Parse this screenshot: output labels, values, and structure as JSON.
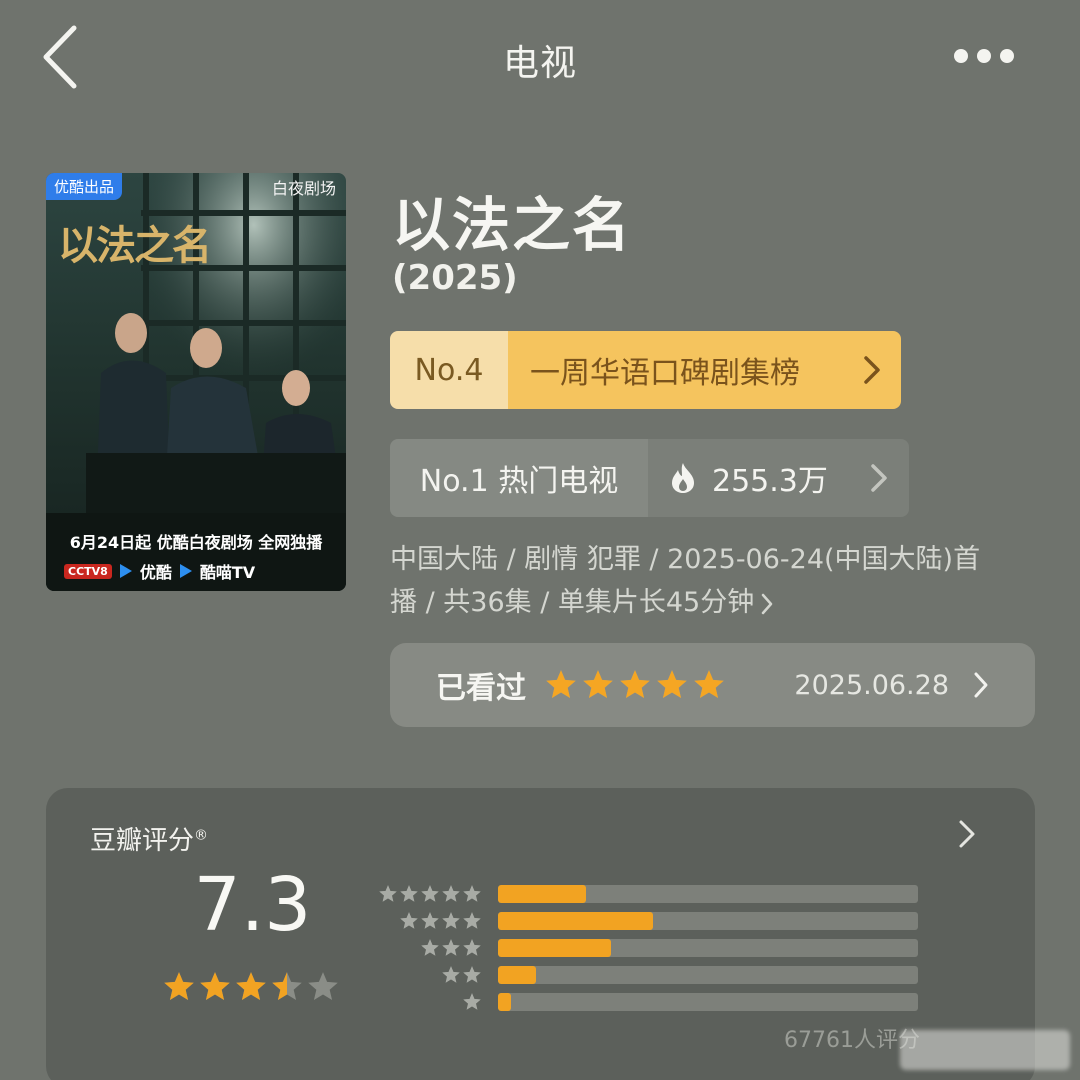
{
  "header": {
    "title": "电视",
    "icons": {
      "back": "chevron-left-icon",
      "more": "more-dots-icon"
    }
  },
  "poster": {
    "badge": "优酷出品",
    "brand": "白夜剧场",
    "title": "以法之名",
    "date_line": "6月24日起 优酷白夜剧场 全网独播",
    "platforms": [
      "CCTV8",
      "优酷",
      "酷喵TV"
    ]
  },
  "show": {
    "title": "以法之名",
    "year": "(2025)"
  },
  "ranking": {
    "number": "No.4",
    "label": "一周华语口碑剧集榜",
    "colors": {
      "number_bg": "#f6deaa",
      "label_bg": "#f5c45e"
    }
  },
  "hot": {
    "rank": "No.1 热门电视",
    "count": "255.3万",
    "icon": "flame-icon"
  },
  "meta": {
    "line1": "中国大陆 / 剧情 犯罪 / 2025-06-24(中国大陆)首",
    "line2": "播 / 共36集 / 单集片长45分钟"
  },
  "watched": {
    "label": "已看过",
    "stars": 5,
    "date": "2025.06.28"
  },
  "douban": {
    "title": "豆瓣评分",
    "registered_mark": "®",
    "score": "7.3",
    "score_stars": 3.5,
    "distribution": [
      {
        "stars": 5,
        "fraction": 0.21
      },
      {
        "stars": 4,
        "fraction": 0.37
      },
      {
        "stars": 3,
        "fraction": 0.27
      },
      {
        "stars": 2,
        "fraction": 0.09
      },
      {
        "stars": 1,
        "fraction": 0.03
      }
    ],
    "rating_count": "67761人评分",
    "accent_color": "#f2a322"
  }
}
